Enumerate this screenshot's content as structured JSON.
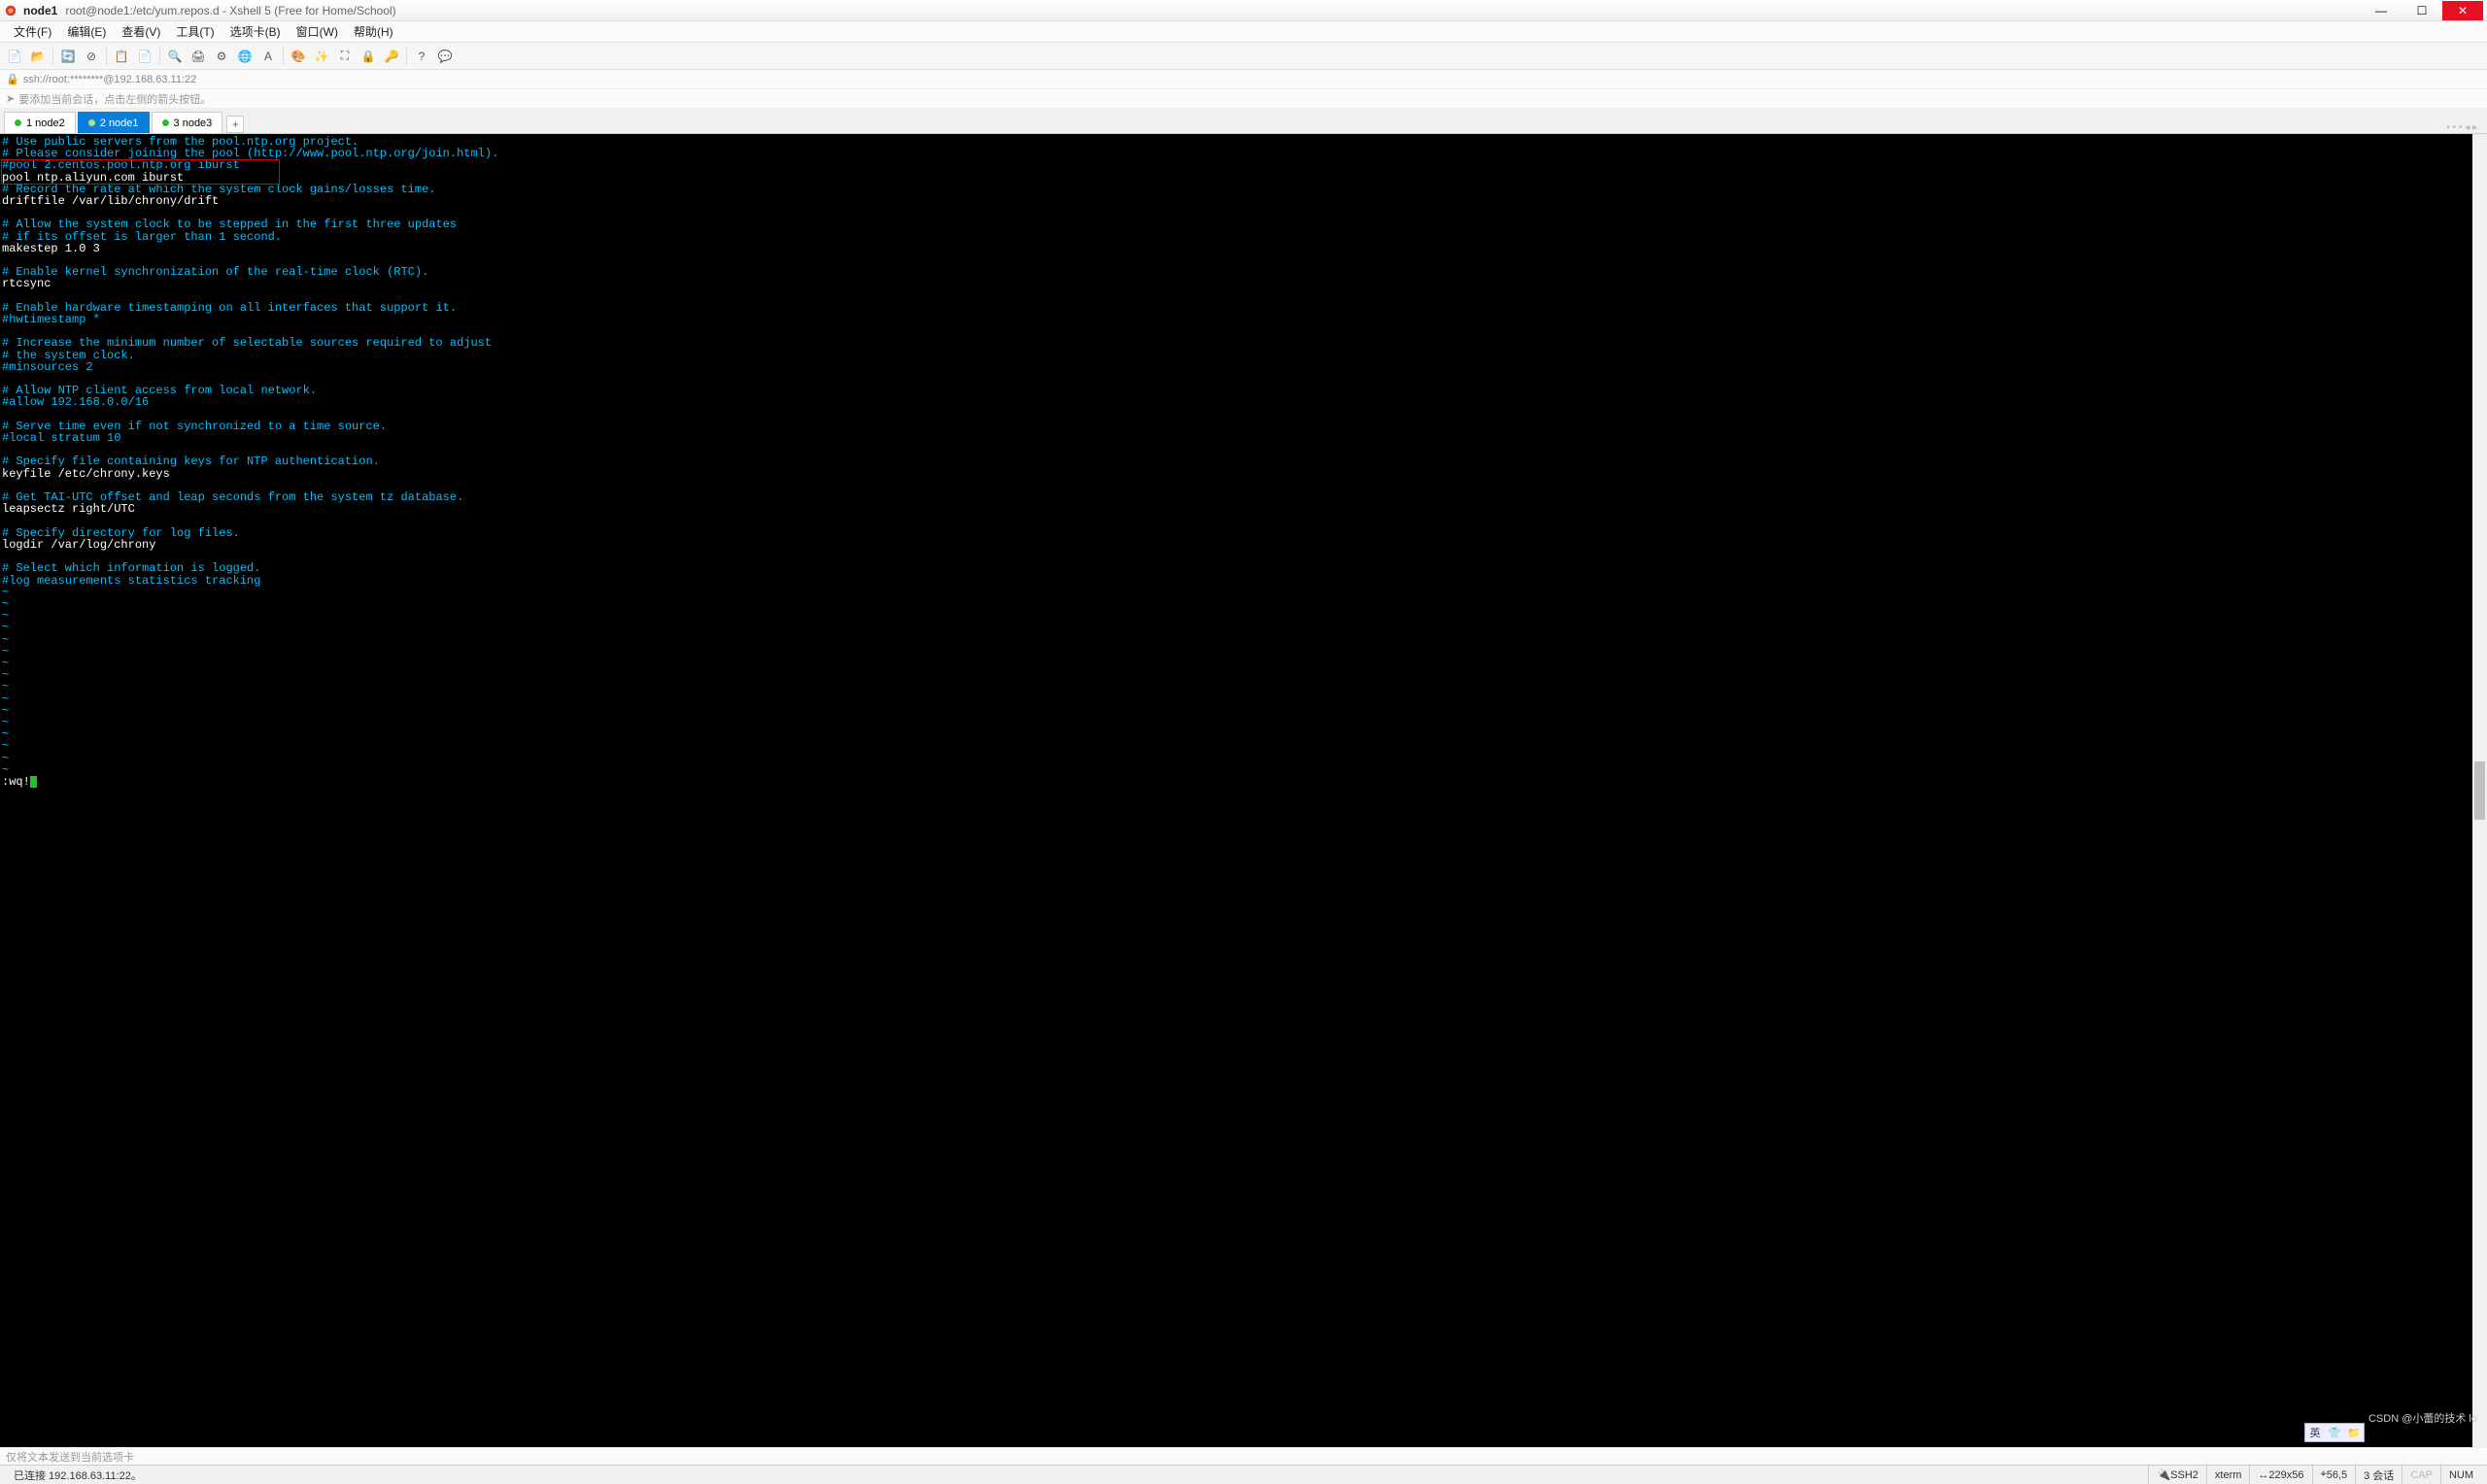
{
  "titlebar": {
    "session": "node1",
    "path": "root@node1:/etc/yum.repos.d - Xshell 5 (Free for Home/School)"
  },
  "menu": {
    "file": "文件(F)",
    "edit": "编辑(E)",
    "view": "查看(V)",
    "tools": "工具(T)",
    "tabs": "选项卡(B)",
    "window": "窗口(W)",
    "help": "帮助(H)"
  },
  "address": {
    "url": "ssh://root:********@192.168.63.11:22"
  },
  "hint": {
    "text": "要添加当前会话，点击左侧的箭头按钮。"
  },
  "tabs": [
    {
      "label": "1 node2",
      "active": false
    },
    {
      "label": "2 node1",
      "active": true
    },
    {
      "label": "3 node3",
      "active": false
    }
  ],
  "terminal": {
    "lines": [
      {
        "cls": "c",
        "t": "# Use public servers from the pool.ntp.org project."
      },
      {
        "cls": "c",
        "t": "# Please consider joining the pool (http://www.pool.ntp.org/join.html)."
      },
      {
        "cls": "c",
        "t": "#pool 2.centos.pool.ntp.org iburst"
      },
      {
        "cls": "w",
        "t": "pool ntp.aliyun.com iburst"
      },
      {
        "cls": "c",
        "t": "# Record the rate at which the system clock gains/losses time."
      },
      {
        "cls": "w",
        "t": "driftfile /var/lib/chrony/drift"
      },
      {
        "cls": "w",
        "t": ""
      },
      {
        "cls": "c",
        "t": "# Allow the system clock to be stepped in the first three updates"
      },
      {
        "cls": "c",
        "t": "# if its offset is larger than 1 second."
      },
      {
        "cls": "w",
        "t": "makestep 1.0 3"
      },
      {
        "cls": "w",
        "t": ""
      },
      {
        "cls": "c",
        "t": "# Enable kernel synchronization of the real-time clock (RTC)."
      },
      {
        "cls": "w",
        "t": "rtcsync"
      },
      {
        "cls": "w",
        "t": ""
      },
      {
        "cls": "c",
        "t": "# Enable hardware timestamping on all interfaces that support it."
      },
      {
        "cls": "c",
        "t": "#hwtimestamp *"
      },
      {
        "cls": "w",
        "t": ""
      },
      {
        "cls": "c",
        "t": "# Increase the minimum number of selectable sources required to adjust"
      },
      {
        "cls": "c",
        "t": "# the system clock."
      },
      {
        "cls": "c",
        "t": "#minsources 2"
      },
      {
        "cls": "w",
        "t": ""
      },
      {
        "cls": "c",
        "t": "# Allow NTP client access from local network."
      },
      {
        "cls": "c",
        "t": "#allow 192.168.0.0/16"
      },
      {
        "cls": "w",
        "t": ""
      },
      {
        "cls": "c",
        "t": "# Serve time even if not synchronized to a time source."
      },
      {
        "cls": "c",
        "t": "#local stratum 10"
      },
      {
        "cls": "w",
        "t": ""
      },
      {
        "cls": "c",
        "t": "# Specify file containing keys for NTP authentication."
      },
      {
        "cls": "w",
        "t": "keyfile /etc/chrony.keys"
      },
      {
        "cls": "w",
        "t": ""
      },
      {
        "cls": "c",
        "t": "# Get TAI-UTC offset and leap seconds from the system tz database."
      },
      {
        "cls": "w",
        "t": "leapsectz right/UTC"
      },
      {
        "cls": "w",
        "t": ""
      },
      {
        "cls": "c",
        "t": "# Specify directory for log files."
      },
      {
        "cls": "w",
        "t": "logdir /var/log/chrony"
      },
      {
        "cls": "w",
        "t": ""
      },
      {
        "cls": "c",
        "t": "# Select which information is logged."
      },
      {
        "cls": "c",
        "t": "#log measurements statistics tracking"
      }
    ],
    "tildes": 16,
    "cmdline": ":wq!"
  },
  "ime": {
    "btn1": "英",
    "btn2": "👕",
    "btn3": "📁"
  },
  "hint2": {
    "text": "仅将文本发送到当前选项卡"
  },
  "status": {
    "conn": "已连接 192.168.63.11:22。",
    "proto": "SSH2",
    "term": "xterm",
    "size": "229x56",
    "cursor": "56,5",
    "sess": "3 会话",
    "caps": "CAP",
    "num": "NUM"
  },
  "watermark": "CSDN @小蕾的技术 lo"
}
